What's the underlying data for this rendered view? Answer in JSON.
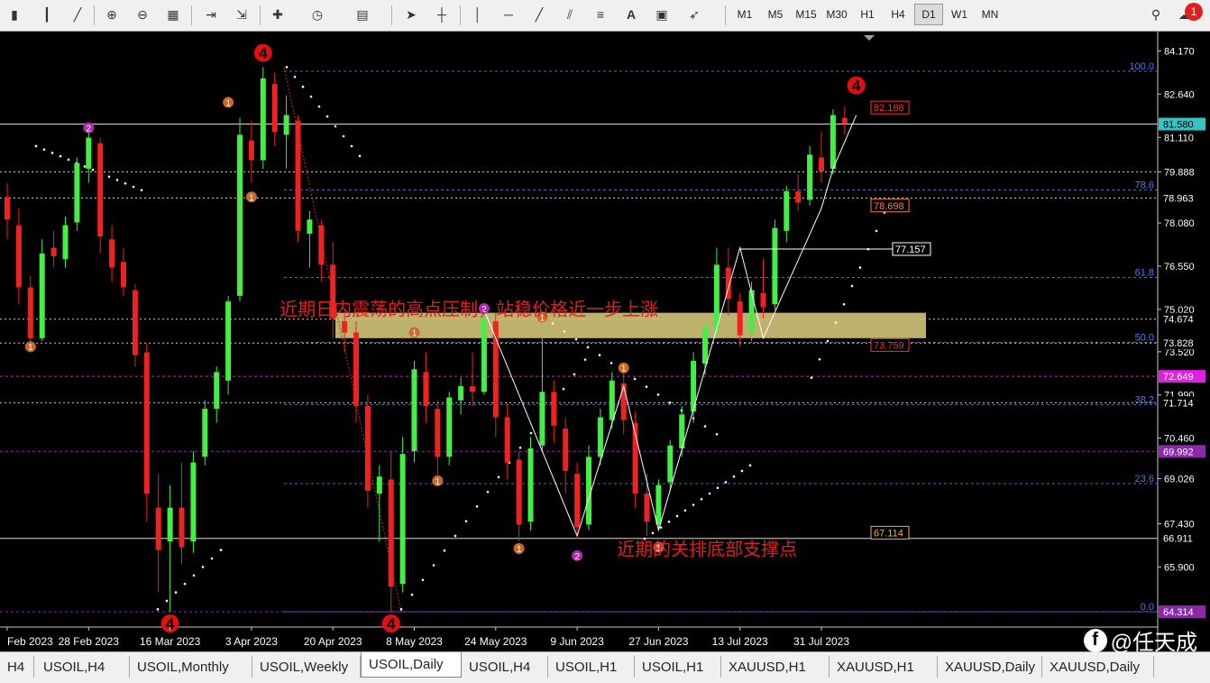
{
  "toolbar": {
    "timeframes": [
      "M1",
      "M5",
      "M15",
      "M30",
      "H1",
      "H4",
      "D1",
      "W1",
      "MN"
    ],
    "active_timeframe": "D1",
    "alert_count": "1",
    "text_tool": "A"
  },
  "symbol_tabs": {
    "first_partial": "H4",
    "items": [
      "USOIL,H4",
      "USOIL,Monthly",
      "USOIL,Weekly",
      "USOIL,Daily",
      "USOIL,H4",
      "USOIL,H1",
      "USOIL,H1",
      "XAUUSD,H1",
      "XAUUSD,H1",
      "XAUUSD,Daily",
      "XAUUSD,Daily"
    ],
    "active_index": 3
  },
  "watermark": {
    "icon": "facebook-icon",
    "text": "@任天成"
  },
  "chart_data": {
    "type": "candlestick",
    "symbol": "USOIL",
    "timeframe": "Daily",
    "y_ticks": [
      84.17,
      82.64,
      81.11,
      79.888,
      78.08,
      76.55,
      75.02,
      73.52,
      71.99,
      70.46,
      69.026,
      67.43,
      65.9
    ],
    "y_range": [
      63.9,
      84.6
    ],
    "x_labels": [
      "Feb 2023",
      "28 Feb 2023",
      "16 Mar 2023",
      "3 Apr 2023",
      "20 Apr 2023",
      "8 May 2023",
      "24 May 2023",
      "9 Jun 2023",
      "27 Jun 2023",
      "13 Jul 2023",
      "31 Jul 2023"
    ],
    "x_label_bars": [
      0,
      7,
      14,
      21,
      28,
      35,
      42,
      49,
      56,
      63,
      70
    ],
    "price_tags": [
      {
        "text": "81.580",
        "bg": "#33c4c4",
        "fg": "#000000",
        "price": 81.58
      },
      {
        "text": "78.963",
        "bg": "#000000",
        "fg": "#ffffff",
        "price": 78.963
      },
      {
        "text": "74.674",
        "bg": "#000000",
        "fg": "#ffffff",
        "price": 74.674
      },
      {
        "text": "73.828",
        "bg": "#000000",
        "fg": "#ffffff",
        "price": 73.828
      },
      {
        "text": "72.649",
        "bg": "#e020e0",
        "fg": "#ffffff",
        "price": 72.649
      },
      {
        "text": "71.714",
        "bg": "#000000",
        "fg": "#ffffff",
        "price": 71.714
      },
      {
        "text": "69.992",
        "bg": "#8a2aa8",
        "fg": "#ffffff",
        "price": 69.992
      },
      {
        "text": "66.911",
        "bg": "#000000",
        "fg": "#ffffff",
        "price": 66.911
      },
      {
        "text": "64.314",
        "bg": "#8a2aa8",
        "fg": "#ffffff",
        "price": 64.314
      }
    ],
    "fib_levels": [
      {
        "label": "100.0",
        "price": 83.45
      },
      {
        "label": "78.6",
        "price": 79.25
      },
      {
        "label": "61.8",
        "price": 76.15
      },
      {
        "label": "50.0",
        "price": 73.85
      },
      {
        "label": "38.2",
        "price": 71.65
      },
      {
        "label": "23.6",
        "price": 68.85
      },
      {
        "label": "0.0",
        "price": 64.314
      }
    ],
    "boxed_labels": [
      {
        "text": "82.168",
        "price": 82.168,
        "color": "#ff3030"
      },
      {
        "text": "78.698",
        "price": 78.698,
        "color": "#ff7a3a"
      },
      {
        "text": "77.157",
        "price": 77.157,
        "color": "#ffffff"
      },
      {
        "text": "73.759",
        "price": 73.759,
        "color": "#ff3030"
      },
      {
        "text": "67.114",
        "price": 67.114,
        "color": "#ffb030"
      }
    ],
    "resistance_zone": {
      "top": 74.9,
      "bottom": 74.0
    },
    "annotations": [
      {
        "text": "近期日内震荡的高点压制，站稳价格近一步上涨",
        "price": 75.0,
        "bar": 29
      },
      {
        "text": "近期的关排底部支撑点",
        "price": 66.5,
        "bar": 58
      }
    ],
    "wave_markers": [
      {
        "label": "4",
        "bar": 22,
        "price": 84.1,
        "style": "big"
      },
      {
        "label": "4",
        "bar": 14,
        "price": 63.9,
        "style": "big"
      },
      {
        "label": "4",
        "bar": 33,
        "price": 63.9,
        "style": "big"
      },
      {
        "label": "4",
        "bar": 73,
        "price": 82.95,
        "style": "big"
      },
      {
        "label": "2",
        "bar": 7,
        "price": 81.45,
        "style": "purple"
      },
      {
        "label": "1",
        "bar": 19,
        "price": 82.35,
        "style": "orange"
      },
      {
        "label": "1",
        "bar": 21,
        "price": 79.0,
        "style": "orange"
      },
      {
        "label": "1",
        "bar": 2,
        "price": 73.7,
        "style": "orange"
      },
      {
        "label": "2",
        "bar": 41,
        "price": 75.05,
        "style": "purple"
      },
      {
        "label": "1",
        "bar": 35,
        "price": 74.2,
        "style": "orange"
      },
      {
        "label": "1",
        "bar": 46,
        "price": 74.75,
        "style": "orange"
      },
      {
        "label": "1",
        "bar": 37,
        "price": 68.95,
        "style": "orange"
      },
      {
        "label": "1",
        "bar": 44,
        "price": 66.55,
        "style": "orange"
      },
      {
        "label": "2",
        "bar": 49,
        "price": 66.3,
        "style": "purple"
      },
      {
        "label": "1",
        "bar": 53,
        "price": 72.95,
        "style": "orange"
      },
      {
        "label": "1",
        "bar": 56,
        "price": 66.6,
        "style": "orange"
      }
    ],
    "zigzag": [
      [
        41,
        75.0
      ],
      [
        49,
        67.0
      ],
      [
        53,
        72.3
      ],
      [
        56,
        67.2
      ],
      [
        63,
        77.2
      ],
      [
        65,
        74.0
      ],
      [
        70,
        78.6
      ],
      [
        71,
        80.0
      ],
      [
        73,
        81.9
      ]
    ],
    "colors": {
      "bull": "#44ee44",
      "bear": "#ee2222",
      "grid_dash": "#4a6ad8",
      "white_dots": "#ffffff",
      "zone": "#d2c47a"
    },
    "candles": [
      [
        79.0,
        79.5,
        77.5,
        78.2
      ],
      [
        78.0,
        78.6,
        75.2,
        75.8
      ],
      [
        75.8,
        76.2,
        73.5,
        74.0
      ],
      [
        74.0,
        77.5,
        73.9,
        77.0
      ],
      [
        77.2,
        77.8,
        76.5,
        76.9
      ],
      [
        76.8,
        78.3,
        76.5,
        78.0
      ],
      [
        78.1,
        80.4,
        77.8,
        80.2
      ],
      [
        80.0,
        81.6,
        79.5,
        81.1
      ],
      [
        80.9,
        81.1,
        77.0,
        77.6
      ],
      [
        77.5,
        78.0,
        76.0,
        76.5
      ],
      [
        76.7,
        77.2,
        75.5,
        75.8
      ],
      [
        75.7,
        75.9,
        73.0,
        73.4
      ],
      [
        73.5,
        73.8,
        67.5,
        68.5
      ],
      [
        68.0,
        69.2,
        65.0,
        66.5
      ],
      [
        66.8,
        68.8,
        64.3,
        68.0
      ],
      [
        68.0,
        69.6,
        66.0,
        66.6
      ],
      [
        66.8,
        70.0,
        66.4,
        69.6
      ],
      [
        69.8,
        71.8,
        69.5,
        71.5
      ],
      [
        71.5,
        73.0,
        71.0,
        72.8
      ],
      [
        72.5,
        75.5,
        72.0,
        75.3
      ],
      [
        75.5,
        81.8,
        75.3,
        81.2
      ],
      [
        81.0,
        81.7,
        79.5,
        80.3
      ],
      [
        80.3,
        83.6,
        80.0,
        83.2
      ],
      [
        83.0,
        83.4,
        80.8,
        81.3
      ],
      [
        81.2,
        82.6,
        80.0,
        81.9
      ],
      [
        81.7,
        81.9,
        77.4,
        77.8
      ],
      [
        77.7,
        78.5,
        76.5,
        78.2
      ],
      [
        78.0,
        78.2,
        76.0,
        76.6
      ],
      [
        76.6,
        77.4,
        74.0,
        74.7
      ],
      [
        74.6,
        75.0,
        73.5,
        74.2
      ],
      [
        74.2,
        74.6,
        71.0,
        71.6
      ],
      [
        71.6,
        72.0,
        68.0,
        68.6
      ],
      [
        68.5,
        69.5,
        66.8,
        69.1
      ],
      [
        69.0,
        70.0,
        64.3,
        65.2
      ],
      [
        65.3,
        70.5,
        65.0,
        69.9
      ],
      [
        70.0,
        73.2,
        69.6,
        72.9
      ],
      [
        72.8,
        73.5,
        71.0,
        71.6
      ],
      [
        71.5,
        71.8,
        69.0,
        69.8
      ],
      [
        69.8,
        72.1,
        69.5,
        71.9
      ],
      [
        71.8,
        72.6,
        71.3,
        72.3
      ],
      [
        72.3,
        73.5,
        71.6,
        72.1
      ],
      [
        72.1,
        75.0,
        72.0,
        74.7
      ],
      [
        74.6,
        74.9,
        70.5,
        71.2
      ],
      [
        71.2,
        71.7,
        69.0,
        69.6
      ],
      [
        69.7,
        70.0,
        66.8,
        67.4
      ],
      [
        67.5,
        70.5,
        67.2,
        70.1
      ],
      [
        70.2,
        74.5,
        70.0,
        72.1
      ],
      [
        72.1,
        72.5,
        70.3,
        70.9
      ],
      [
        70.8,
        71.2,
        68.5,
        69.3
      ],
      [
        69.2,
        69.6,
        66.9,
        67.3
      ],
      [
        67.4,
        70.2,
        67.2,
        69.8
      ],
      [
        69.8,
        71.5,
        69.5,
        71.2
      ],
      [
        71.1,
        72.8,
        70.8,
        72.5
      ],
      [
        72.4,
        72.8,
        70.6,
        71.1
      ],
      [
        71.0,
        71.4,
        68.0,
        68.5
      ],
      [
        68.5,
        69.2,
        67.0,
        67.5
      ],
      [
        67.4,
        69.0,
        67.2,
        68.8
      ],
      [
        68.9,
        70.4,
        68.6,
        70.2
      ],
      [
        70.1,
        71.6,
        69.8,
        71.3
      ],
      [
        71.4,
        73.5,
        71.0,
        73.2
      ],
      [
        73.1,
        74.6,
        72.7,
        74.4
      ],
      [
        74.3,
        77.2,
        74.0,
        76.6
      ],
      [
        76.5,
        77.2,
        74.8,
        75.4
      ],
      [
        75.3,
        75.6,
        73.7,
        74.1
      ],
      [
        74.2,
        76.0,
        73.9,
        75.7
      ],
      [
        75.6,
        76.8,
        74.7,
        75.1
      ],
      [
        75.2,
        78.2,
        75.0,
        77.9
      ],
      [
        77.8,
        79.4,
        77.4,
        79.2
      ],
      [
        79.2,
        79.8,
        78.5,
        78.8
      ],
      [
        78.9,
        80.8,
        78.7,
        80.5
      ],
      [
        80.4,
        81.3,
        79.5,
        79.9
      ],
      [
        80.0,
        82.1,
        79.8,
        81.9
      ],
      [
        81.8,
        82.2,
        81.2,
        81.6
      ]
    ]
  }
}
